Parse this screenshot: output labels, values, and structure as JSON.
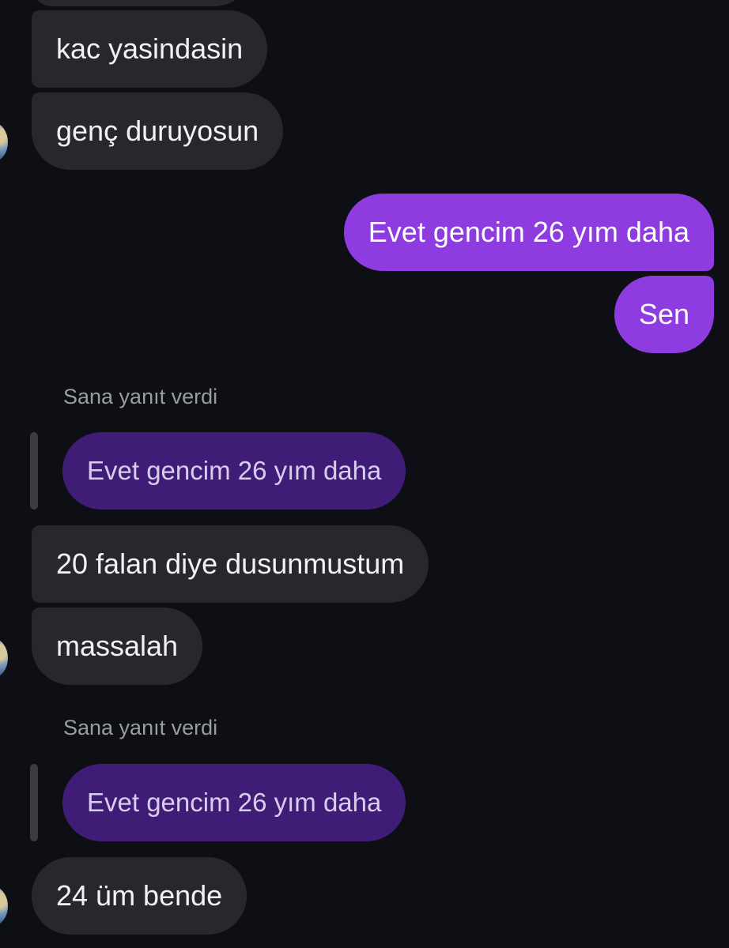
{
  "messages": [
    {
      "text": "kac yasindasin"
    },
    {
      "text": "genç duruyosun"
    },
    {
      "text": "Evet gencim 26 yım daha"
    },
    {
      "text": "Sen"
    },
    {
      "text": "20 falan diye dusunmustum"
    },
    {
      "text": "massalah"
    },
    {
      "text": "24 üm bende"
    }
  ],
  "replies": [
    {
      "label": "Sana yanıt verdi",
      "quoted": "Evet gencim 26 yım daha"
    },
    {
      "label": "Sana yanıt verdi",
      "quoted": "Evet gencim 26 yım daha"
    }
  ],
  "colors": {
    "background": "#0d0f14",
    "incoming_bubble": "#26282d",
    "outgoing_bubble": "#8e3be0",
    "quoted_bubble": "#3f1d76",
    "meta_text": "#9a9ca3"
  },
  "icons": {
    "avatar": "contact-avatar-icon"
  }
}
